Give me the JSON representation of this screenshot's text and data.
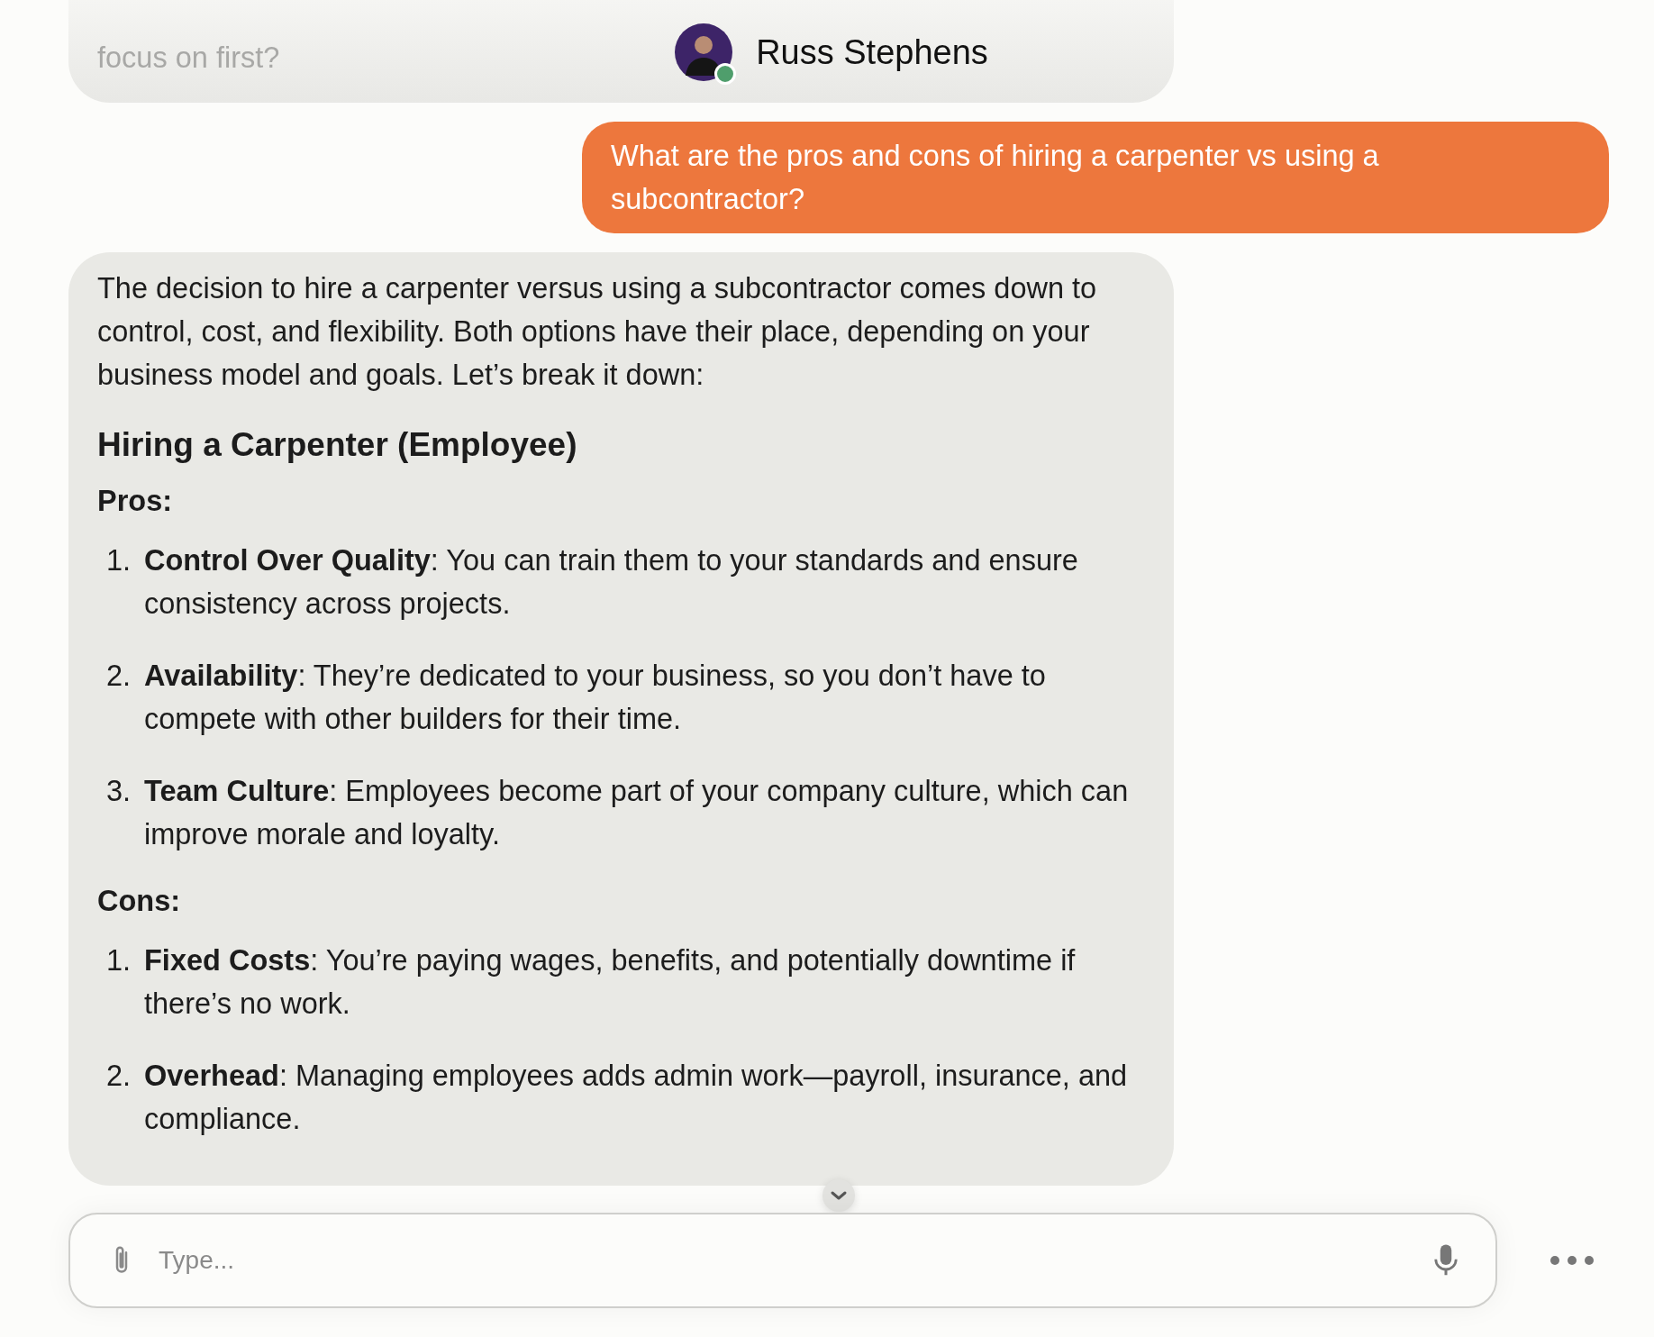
{
  "header": {
    "name": "Russ Stephens",
    "online": true
  },
  "messages": [
    {
      "kind": "faded",
      "blocks": [
        {
          "kind": "paragraph",
          "text": "focus on first?"
        }
      ]
    },
    {
      "kind": "user",
      "blocks": [
        {
          "kind": "paragraph",
          "text": "What are the pros and cons of hiring a carpenter vs using a subcontractor?"
        }
      ]
    },
    {
      "kind": "assistant",
      "blocks": [
        {
          "kind": "paragraph",
          "text": "The decision to hire a carpenter versus using a subcontractor comes down to control, cost, and flexibility. Both options have their place, depending on your business model and goals. Let’s break it down:"
        },
        {
          "kind": "heading",
          "text": "Hiring a Carpenter (Employee)"
        },
        {
          "kind": "label",
          "text": "Pros:"
        },
        {
          "kind": "list",
          "items": [
            {
              "number": "1.",
              "text": "**Control Over Quality**: You can train them to your standards and ensure consistency across projects."
            },
            {
              "number": "2.",
              "text": "**Availability**: They’re dedicated to your business, so you don’t have to compete with other builders for their time."
            },
            {
              "number": "3.",
              "text": "**Team Culture**: Employees become part of your company culture, which can improve morale and loyalty."
            }
          ]
        },
        {
          "kind": "label",
          "text": "Cons:"
        },
        {
          "kind": "list",
          "items": [
            {
              "number": "1.",
              "text": "**Fixed Costs**: You’re paying wages, benefits, and potentially downtime if there’s no work."
            },
            {
              "number": "2.",
              "text": "**Overhead**: Managing employees adds admin work—payroll, insurance, and compliance."
            }
          ]
        }
      ]
    }
  ],
  "composer": {
    "placeholder": "Type..."
  }
}
